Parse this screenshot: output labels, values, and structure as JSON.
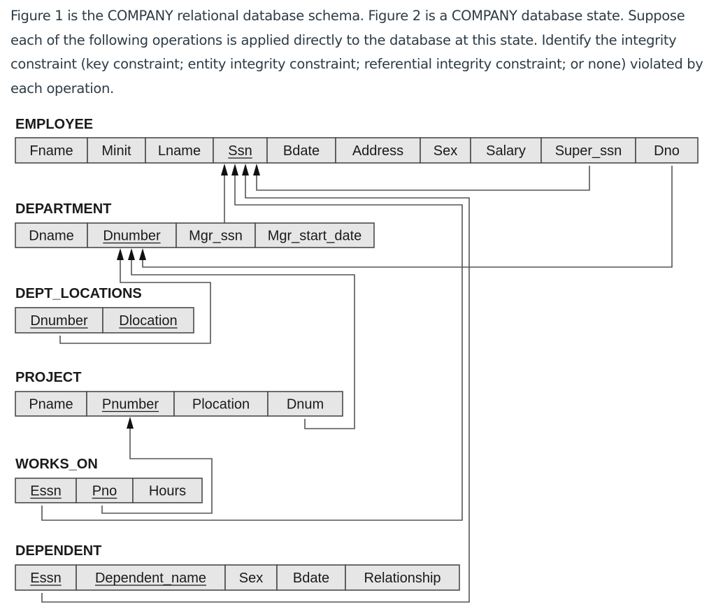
{
  "question": {
    "text": "Figure 1 is the COMPANY relational database schema. Figure 2 is a COMPANY database state. Suppose each of the following operations is applied directly to the database at this state. Identify the integrity constraint (key constraint; entity integrity constraint; referential integrity constraint; or none) violated by each operation."
  },
  "schema": {
    "tables": [
      {
        "name": "EMPLOYEE",
        "columns": [
          {
            "name": "Fname",
            "pk": false
          },
          {
            "name": "Minit",
            "pk": false
          },
          {
            "name": "Lname",
            "pk": false
          },
          {
            "name": "Ssn",
            "pk": true
          },
          {
            "name": "Bdate",
            "pk": false
          },
          {
            "name": "Address",
            "pk": false
          },
          {
            "name": "Sex",
            "pk": false
          },
          {
            "name": "Salary",
            "pk": false
          },
          {
            "name": "Super_ssn",
            "pk": false
          },
          {
            "name": "Dno",
            "pk": false
          }
        ]
      },
      {
        "name": "DEPARTMENT",
        "columns": [
          {
            "name": "Dname",
            "pk": false
          },
          {
            "name": "Dnumber",
            "pk": true
          },
          {
            "name": "Mgr_ssn",
            "pk": false
          },
          {
            "name": "Mgr_start_date",
            "pk": false
          }
        ]
      },
      {
        "name": "DEPT_LOCATIONS",
        "columns": [
          {
            "name": "Dnumber",
            "pk": true
          },
          {
            "name": "Dlocation",
            "pk": true
          }
        ]
      },
      {
        "name": "PROJECT",
        "columns": [
          {
            "name": "Pname",
            "pk": false
          },
          {
            "name": "Pnumber",
            "pk": true
          },
          {
            "name": "Plocation",
            "pk": false
          },
          {
            "name": "Dnum",
            "pk": false
          }
        ]
      },
      {
        "name": "WORKS_ON",
        "columns": [
          {
            "name": "Essn",
            "pk": true
          },
          {
            "name": "Pno",
            "pk": true
          },
          {
            "name": "Hours",
            "pk": false
          }
        ]
      },
      {
        "name": "DEPENDENT",
        "columns": [
          {
            "name": "Essn",
            "pk": true
          },
          {
            "name": "Dependent_name",
            "pk": true
          },
          {
            "name": "Sex",
            "pk": false
          },
          {
            "name": "Bdate",
            "pk": false
          },
          {
            "name": "Relationship",
            "pk": false
          }
        ]
      }
    ],
    "foreign_keys": [
      {
        "from": "DEPARTMENT.Mgr_ssn",
        "to": "EMPLOYEE.Ssn"
      },
      {
        "from": "WORKS_ON.Essn",
        "to": "EMPLOYEE.Ssn"
      },
      {
        "from": "DEPENDENT.Essn",
        "to": "EMPLOYEE.Ssn"
      },
      {
        "from": "EMPLOYEE.Super_ssn",
        "to": "EMPLOYEE.Ssn"
      },
      {
        "from": "DEPT_LOCATIONS.Dnumber",
        "to": "DEPARTMENT.Dnumber"
      },
      {
        "from": "PROJECT.Dnum",
        "to": "DEPARTMENT.Dnumber"
      },
      {
        "from": "EMPLOYEE.Dno",
        "to": "DEPARTMENT.Dnumber"
      },
      {
        "from": "WORKS_ON.Pno",
        "to": "PROJECT.Pnumber"
      }
    ]
  }
}
